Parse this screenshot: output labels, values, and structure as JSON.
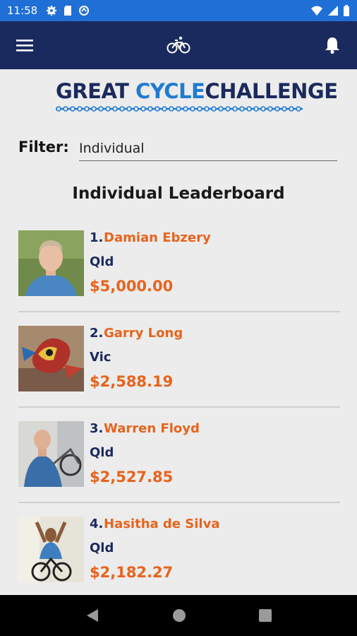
{
  "status_bar": {
    "time": "11:58"
  },
  "app_bar": {
    "menu_icon": "hamburger-icon",
    "center_icon": "bicycle-icon",
    "notification_icon": "bell-icon"
  },
  "logo": {
    "word1": "GREAT",
    "word2": "CYCLE",
    "word3": "CHALLENGE"
  },
  "filter": {
    "label": "Filter:",
    "value": "Individual"
  },
  "leaderboard": {
    "title": "Individual Leaderboard",
    "entries": [
      {
        "rank": "1.",
        "name": "Damian Ebzery",
        "state": "Qld",
        "amount": "$5,000.00"
      },
      {
        "rank": "2.",
        "name": "Garry Long",
        "state": "Vic",
        "amount": "$2,588.19"
      },
      {
        "rank": "3.",
        "name": "Warren Floyd",
        "state": "Qld",
        "amount": "$2,527.85"
      },
      {
        "rank": "4.",
        "name": "Hasitha de Silva",
        "state": "Qld",
        "amount": "$2,182.27"
      }
    ]
  },
  "colors": {
    "app_bar": "#1b2a5e",
    "status_bar": "#1f6fd6",
    "accent": "#e8631c",
    "navy": "#1b2a5e",
    "logo_blue": "#1f7bd2"
  },
  "nav": {
    "back": "back-icon",
    "home": "home-icon",
    "recents": "recents-icon"
  }
}
